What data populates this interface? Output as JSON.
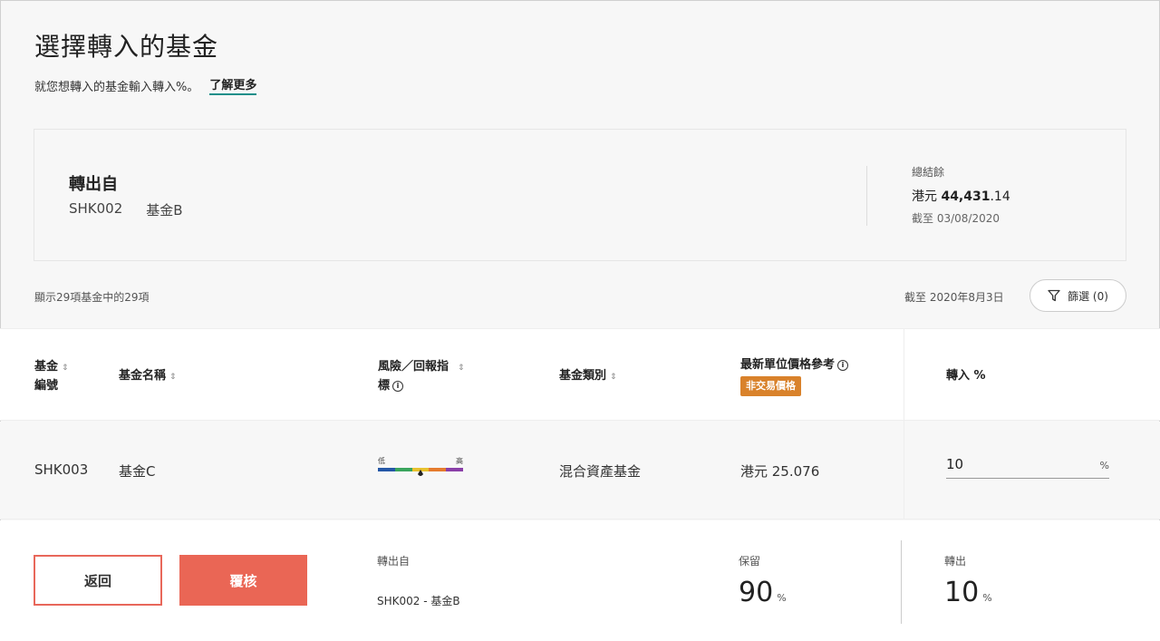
{
  "header": {
    "title": "選擇轉入的基金",
    "subtitle": "就您想轉入的基金輸入轉入%。",
    "learn_more": "了解更多"
  },
  "from_fund": {
    "label": "轉出自",
    "code": "SHK002",
    "name": "基金B",
    "balance_label": "總結餘",
    "balance_currency": "港元",
    "balance_main": "44,431",
    "balance_decimal": ".14",
    "balance_date": "截至 03/08/2020"
  },
  "list_meta": {
    "count": "顯示29項基金中的29項",
    "as_of": "截至 2020年8月3日",
    "filter_label": "篩選 (0)"
  },
  "table": {
    "headers": {
      "code_line1": "基金",
      "code_line2": "編號",
      "name": "基金名稱",
      "risk_line1": "風險／回報指",
      "risk_line2": "標",
      "category": "基金類別",
      "price": "最新單位價格參考",
      "price_badge": "非交易價格",
      "transfer_in": "轉入 %"
    },
    "rows": [
      {
        "code": "SHK003",
        "name": "基金C",
        "risk_low": "低",
        "risk_high": "高",
        "category": "混合資產基金",
        "price": "港元 25.076",
        "transfer_in": "10",
        "pct_symbol": "%"
      }
    ]
  },
  "footer": {
    "back_label": "返回",
    "review_label": "覆核",
    "from_label": "轉出自",
    "from_value": "SHK002 - 基金B",
    "retain_label": "保留",
    "retain_value": "90",
    "out_label": "轉出",
    "out_value": "10",
    "pct_unit": "%"
  },
  "colors": {
    "accent": "#ea6655",
    "badge": "#d9822b",
    "link_underline": "#1c8f8a"
  }
}
